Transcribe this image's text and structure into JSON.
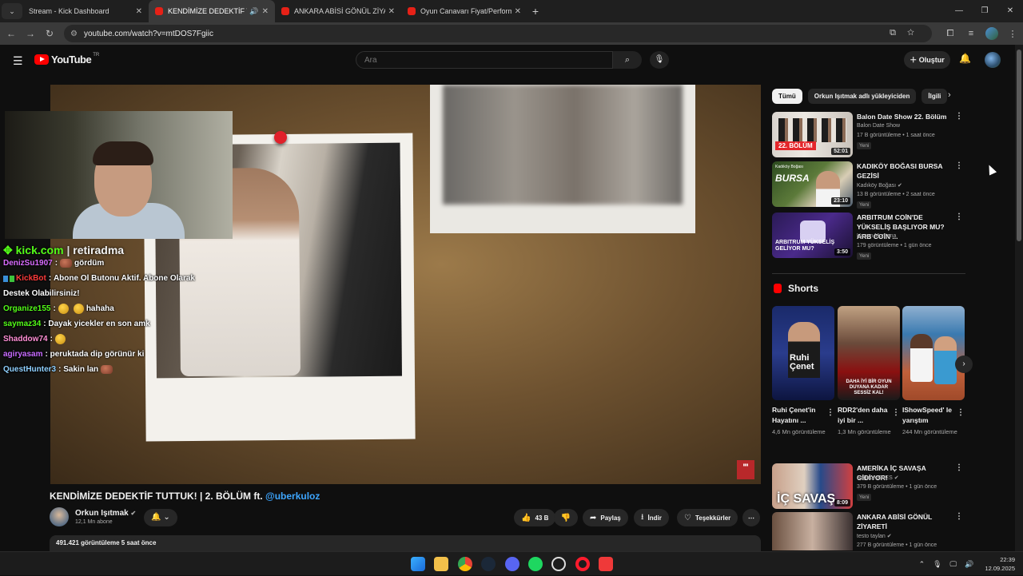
{
  "browser": {
    "tabs": [
      {
        "title": "Stream - Kick Dashboard",
        "favicon": "kick-icon"
      },
      {
        "title": "KENDİMİZE DEDEKTİF TUTT",
        "favicon": "youtube-icon",
        "active": true
      },
      {
        "title": "ANKARA ABİSİ GÖNÜL ZİYARET",
        "favicon": "youtube-icon"
      },
      {
        "title": "Oyun Canavarı Fiyat/Performan",
        "favicon": "youtube-icon"
      }
    ],
    "url": "youtube.com/watch?v=mtDOS7Fgiic"
  },
  "youtube": {
    "region": "TR",
    "logo_text": "YouTube",
    "search_placeholder": "Ara",
    "create_label": "Oluştur"
  },
  "overlay": {
    "kick_brand": "kick.com",
    "kick_sep": "|",
    "kick_user": "retiradma",
    "chat": [
      {
        "user": "DenizSu1907",
        "color": "#d96cff",
        "sep": " :",
        "emote": "r",
        "text": "gördüm"
      },
      {
        "user": "KickBot",
        "color": "#ff3b3b",
        "sep": " :",
        "text": "Abone Ol Butonu Aktif. Abone Olarak",
        "bot": true
      },
      {
        "user": "",
        "color": "#ffffff",
        "sep": "",
        "text": "Destek Olabilirsiniz!"
      },
      {
        "user": "Organize155",
        "color": "#53fc18",
        "sep": " :",
        "emote": "y",
        "emote2": "y",
        "text": "hahaha"
      },
      {
        "user": "saymaz34",
        "color": "#53fc18",
        "sep": " :",
        "text": "Dayak yicekler en son amk"
      },
      {
        "user": "Shaddow74",
        "color": "#ff8fd6",
        "sep": " :",
        "emote": "y",
        "text": ""
      },
      {
        "user": "agiryasam",
        "color": "#c86cff",
        "sep": " :",
        "text": "peruktada dip görünür ki"
      },
      {
        "user": "QuestHunter3",
        "color": "#8fd0ff",
        "sep": " :",
        "text": "Sakin lan",
        "emote_after": "r"
      }
    ]
  },
  "video": {
    "title": "KENDİMİZE DEDEKTİF TUTTUK! | 2. BÖLÜM ft.",
    "mention": "@uberkuloz",
    "channel": "Orkun Işıtmak",
    "subscribers": "12,1 Mn abone",
    "likes": "43 B",
    "share": "Paylaş",
    "download": "İndir",
    "thanks": "Teşekkürler",
    "views_time": "491.421 görüntüleme  5 saat önce"
  },
  "chips": [
    "Tümü",
    "Orkun Işıtmak adlı yükleyiciden",
    "İlgili"
  ],
  "recommendations": [
    {
      "title": "Balon Date Show 22. Bölüm",
      "channel": "Balon Date Show",
      "meta": "17 B görüntüleme • 1 saat önce",
      "duration": "52:01",
      "new": "Yeni",
      "verified": false
    },
    {
      "title": "KADIKÖY BOĞASI BURSA GEZİSİ",
      "channel": "Kadıköy Boğası",
      "meta": "13 B görüntüleme • 2 saat önce",
      "duration": "23:10",
      "new": "Yeni",
      "verified": true
    },
    {
      "title": "ARBITRUM COİN'DE YÜKSELİŞ BAŞLIYOR MU? ARB COİN ...",
      "channel": "Hasan Montana",
      "meta": "179 görüntüleme • 1 gün önce",
      "duration": "3:50",
      "new": "Yeni",
      "verified": false
    },
    {
      "title": "AMERİKA İÇ SAVAŞA GİDİYOR!",
      "channel": "Sadece ENES",
      "meta": "379 B görüntüleme • 1 gün önce",
      "duration": "8:09",
      "new": "Yeni",
      "verified": true
    },
    {
      "title": "ANKARA ABİSİ GÖNÜL ZİYARETİ",
      "channel": "testo taylan",
      "meta": "277 B görüntüleme • 1 gün önce",
      "duration": "",
      "new": "",
      "verified": true
    }
  ],
  "thumb_text": {
    "balon": "22. BÖLÜM",
    "bursa": "BURSA",
    "kadikoy": "Kadıköy Boğası",
    "arb": "ARBITRUM YÜKSELİŞ GELİYOR MU?",
    "america": "İÇ SAVAŞ"
  },
  "shorts_title": "Shorts",
  "shorts": [
    {
      "title": "Ruhi Çenet'in Hayatını ...",
      "views": "4,6 Mn görüntüleme",
      "thumb_text": "Ruhi Çenet"
    },
    {
      "title": "RDR2'den daha iyi bir ...",
      "views": "1,3 Mn görüntüleme",
      "thumb_text": "DAHA İYİ BİR OYUN DUYANA KADAR SESSİZ KAL!"
    },
    {
      "title": "IShowSpeed' le yarıştım",
      "views": "244 Mn görüntüleme",
      "thumb_text": ""
    }
  ],
  "taskbar": {
    "time": "22:39",
    "date": "12.09.2025"
  }
}
